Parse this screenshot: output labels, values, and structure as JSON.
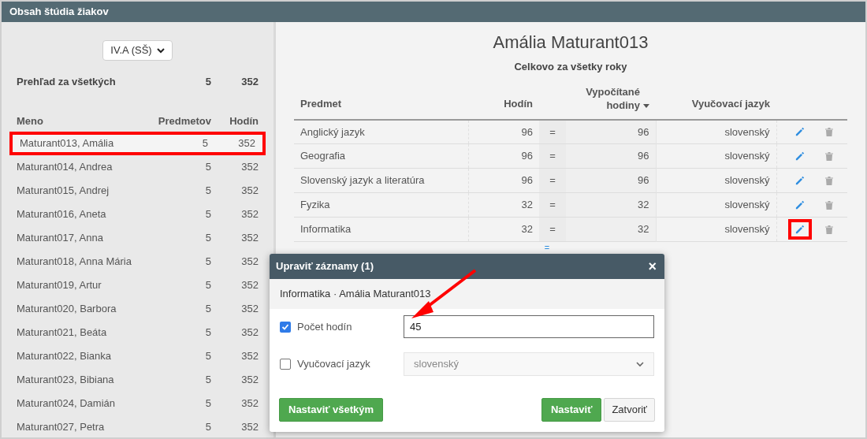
{
  "window": {
    "title": "Obsah štúdia žiakov"
  },
  "class_select": {
    "value": "IV.A (SŠ)"
  },
  "overview": {
    "label": "Prehľad za všetkých",
    "subjects": "5",
    "hours": "352"
  },
  "students": {
    "columns": [
      "Meno",
      "Predmetov",
      "Hodín"
    ],
    "rows": [
      {
        "name": "Maturant013, Amália",
        "subjects": "5",
        "hours": "352",
        "selected": true
      },
      {
        "name": "Maturant014, Andrea",
        "subjects": "5",
        "hours": "352",
        "selected": false
      },
      {
        "name": "Maturant015, Andrej",
        "subjects": "5",
        "hours": "352",
        "selected": false
      },
      {
        "name": "Maturant016, Aneta",
        "subjects": "5",
        "hours": "352",
        "selected": false
      },
      {
        "name": "Maturant017, Anna",
        "subjects": "5",
        "hours": "352",
        "selected": false
      },
      {
        "name": "Maturant018, Anna Mária",
        "subjects": "5",
        "hours": "352",
        "selected": false
      },
      {
        "name": "Maturant019, Artur",
        "subjects": "5",
        "hours": "352",
        "selected": false
      },
      {
        "name": "Maturant020, Barbora",
        "subjects": "5",
        "hours": "352",
        "selected": false
      },
      {
        "name": "Maturant021, Beáta",
        "subjects": "5",
        "hours": "352",
        "selected": false
      },
      {
        "name": "Maturant022, Bianka",
        "subjects": "5",
        "hours": "352",
        "selected": false
      },
      {
        "name": "Maturant023, Bibiana",
        "subjects": "5",
        "hours": "352",
        "selected": false
      },
      {
        "name": "Maturant024, Damián",
        "subjects": "5",
        "hours": "352",
        "selected": false
      },
      {
        "name": "Maturant027, Petra",
        "subjects": "5",
        "hours": "352",
        "selected": false
      }
    ]
  },
  "detail": {
    "title": "Amália Maturant013",
    "subtitle": "Celkovo za všetky roky",
    "columns": [
      "Predmet",
      "Hodín",
      "Vypočítané hodiny",
      "Vyučovací jazyk"
    ],
    "rows": [
      {
        "subject": "Anglický jazyk",
        "hours": "96",
        "eq": "=",
        "computed": "96",
        "language": "slovenský",
        "highlighted": false
      },
      {
        "subject": "Geografia",
        "hours": "96",
        "eq": "=",
        "computed": "96",
        "language": "slovenský",
        "highlighted": false
      },
      {
        "subject": "Slovenský jazyk a literatúra",
        "hours": "96",
        "eq": "=",
        "computed": "96",
        "language": "slovenský",
        "highlighted": false
      },
      {
        "subject": "Fyzika",
        "hours": "32",
        "eq": "=",
        "computed": "32",
        "language": "slovenský",
        "highlighted": false
      },
      {
        "subject": "Informatika",
        "hours": "32",
        "eq": "=",
        "computed": "32",
        "language": "slovenský",
        "highlighted": true
      }
    ],
    "footer_link": "="
  },
  "dialog": {
    "title": "Upraviť záznamy (1)",
    "close": "×",
    "context": "Informatika · Amália Maturant013",
    "fields": [
      {
        "kind": "input",
        "label": "Počet hodín",
        "checked": true,
        "value": "45",
        "disabled": false
      },
      {
        "kind": "select",
        "label": "Vyučovací jazyk",
        "checked": false,
        "value": "slovenský",
        "disabled": true
      }
    ],
    "buttons": {
      "apply_all": "Nastaviť všetkým",
      "apply": "Nastaviť",
      "close": "Zatvoriť"
    }
  }
}
